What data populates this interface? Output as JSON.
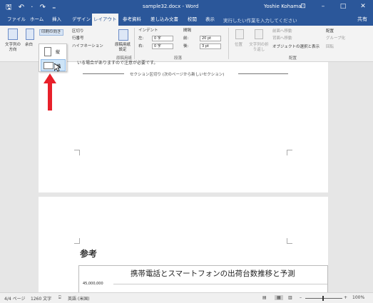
{
  "titlebar": {
    "quick_access": "🖫 ↶ · ↷ ₌",
    "title": "sample32.docx - Word",
    "user": "Yoshie Kohama",
    "ribbon_display": "⊡",
    "minimize": "–",
    "maximize": "□",
    "close": "✕"
  },
  "tabs": [
    "ファイル",
    "ホーム",
    "挿入",
    "デザイン",
    "レイアウト",
    "参考資料",
    "差し込み文書",
    "校閲",
    "表示"
  ],
  "active_tab": "レイアウト",
  "tell_me": "実行したい作業を入力してください",
  "share": "共有",
  "ribbon": {
    "text_direction": "文字列の方向",
    "margins": "余白",
    "orientation": "印刷の向き",
    "breaks": "区切り",
    "line_numbers": "行番号",
    "hyphenation": "ハイフネーション",
    "manuscript": "原稿用紙設定",
    "page_setup_group": "原稿用紙",
    "indent_title": "インデント",
    "spacing_title": "間隔",
    "indent_left_label": "左:",
    "indent_left_value": "0 字",
    "indent_right_label": "右:",
    "indent_right_value": "0 字",
    "spacing_before_label": "前:",
    "spacing_before_value": "20 pt",
    "spacing_after_label": "後:",
    "spacing_after_value": "3 pt",
    "paragraph_group": "段落",
    "position": "位置",
    "wrap_text": "文字列の折り返し",
    "bring_forward": "前面へ移動",
    "send_backward": "背面へ移動",
    "selection_pane": "オブジェクトの選択と表示",
    "align": "配置",
    "group": "グループ化",
    "rotate": "回転",
    "arrange_group": "配置"
  },
  "orientation_menu": {
    "portrait": "縦",
    "landscape": "横"
  },
  "document": {
    "line_top": "いる場合がありますので注意が必要です。",
    "section_break": "セクション区切り (次のページから新しいセクション)",
    "heading": "参考",
    "chart_title": "携帯電話とスマートフォンの出荷台数推移と予測",
    "chart_ytick": "45,000,000"
  },
  "status": {
    "page": "4/4 ページ",
    "words": "1260 文字",
    "lang": "英語 (米国)",
    "zoom": "100%"
  },
  "colors": {
    "accent": "#2b579a",
    "highlight": "#cde4f7",
    "arrow": "#e8202a"
  }
}
